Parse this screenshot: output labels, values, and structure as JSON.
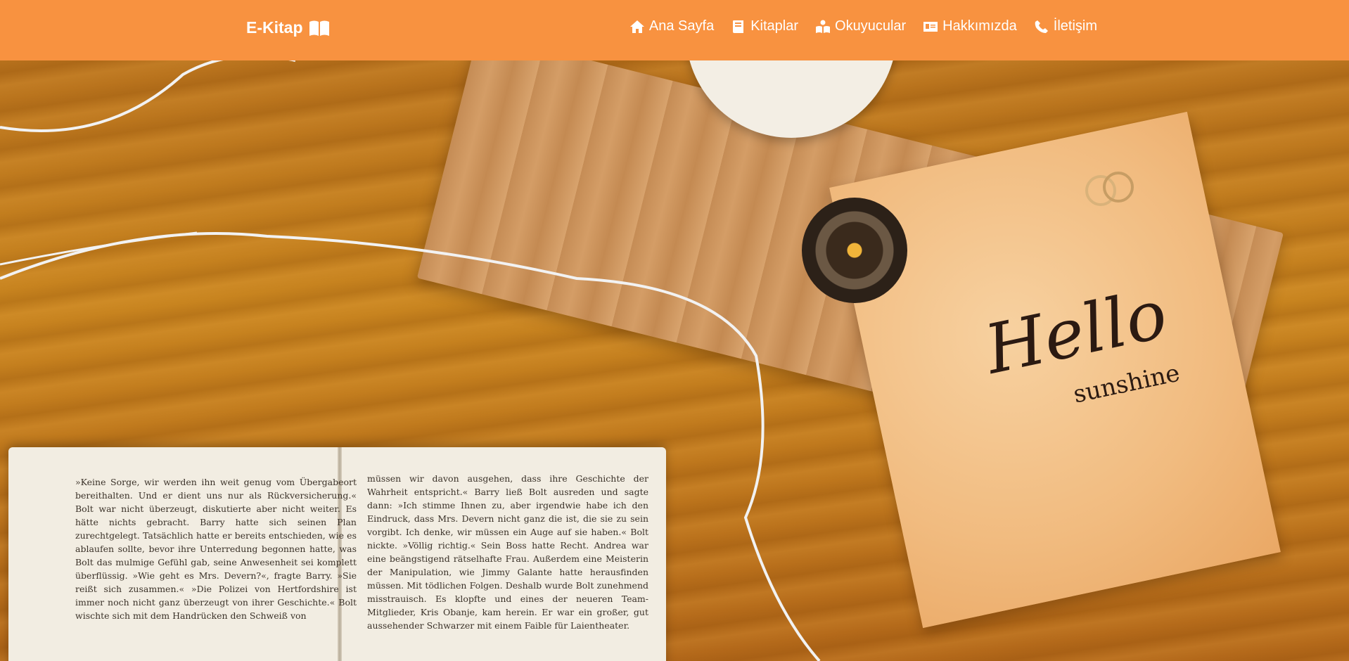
{
  "navbar": {
    "brand": "E-Kitap",
    "brand_icon": "open-book-icon",
    "links": [
      {
        "label": "Ana Sayfa",
        "icon": "home-icon"
      },
      {
        "label": "Kitaplar",
        "icon": "book-icon"
      },
      {
        "label": "Okuyucular",
        "icon": "reader-icon"
      },
      {
        "label": "Hakkımızda",
        "icon": "id-card-icon"
      },
      {
        "label": "İletişim",
        "icon": "phone-icon"
      }
    ]
  },
  "hero": {
    "card_title": "Hello",
    "card_subtitle": "sunshine",
    "book_left_text": "»Keine Sorge, wir werden ihn weit genug vom Übergabeort bereithalten. Und er dient uns nur als Rückversicherung.« Bolt war nicht überzeugt, diskutierte aber nicht weiter. Es hätte nichts gebracht. Barry hatte sich seinen Plan zurechtgelegt. Tatsächlich hatte er bereits entschieden, wie es ablaufen sollte, bevor ihre Unterredung begonnen hatte, was Bolt das mulmige Gefühl gab, seine Anwesenheit sei komplett überflüssig. »Wie geht es Mrs. Devern?«, fragte Barry. »Sie reißt sich zusammen.« »Die Polizei von Hertfordshire ist immer noch nicht ganz überzeugt von ihrer Geschichte.« Bolt wischte sich mit dem Handrücken den Schweiß von",
    "book_right_text": "müssen wir davon ausgehen, dass ihre Geschichte der Wahrheit entspricht.« Barry ließ Bolt ausreden und sagte dann: »Ich stimme Ihnen zu, aber irgendwie habe ich den Eindruck, dass Mrs. Devern nicht ganz die ist, die sie zu sein vorgibt. Ich denke, wir müssen ein Auge auf sie haben.« Bolt nickte. »Völlig richtig.« Sein Boss hatte Recht. Andrea war eine beängstigend rätselhafte Frau. Außerdem eine Meisterin der Manipulation, wie Jimmy Galante hatte herausfinden müssen. Mit tödlichen Folgen. Deshalb wurde Bolt zunehmend misstrauisch. Es klopfte und eines der neueren Team-Mitglieder, Kris Obanje, kam herein. Er war ein großer, gut aussehender Schwarzer mit einem Faible für Laientheater."
  },
  "colors": {
    "navbar_bg": "#f89240",
    "nav_text": "#ffffff"
  }
}
